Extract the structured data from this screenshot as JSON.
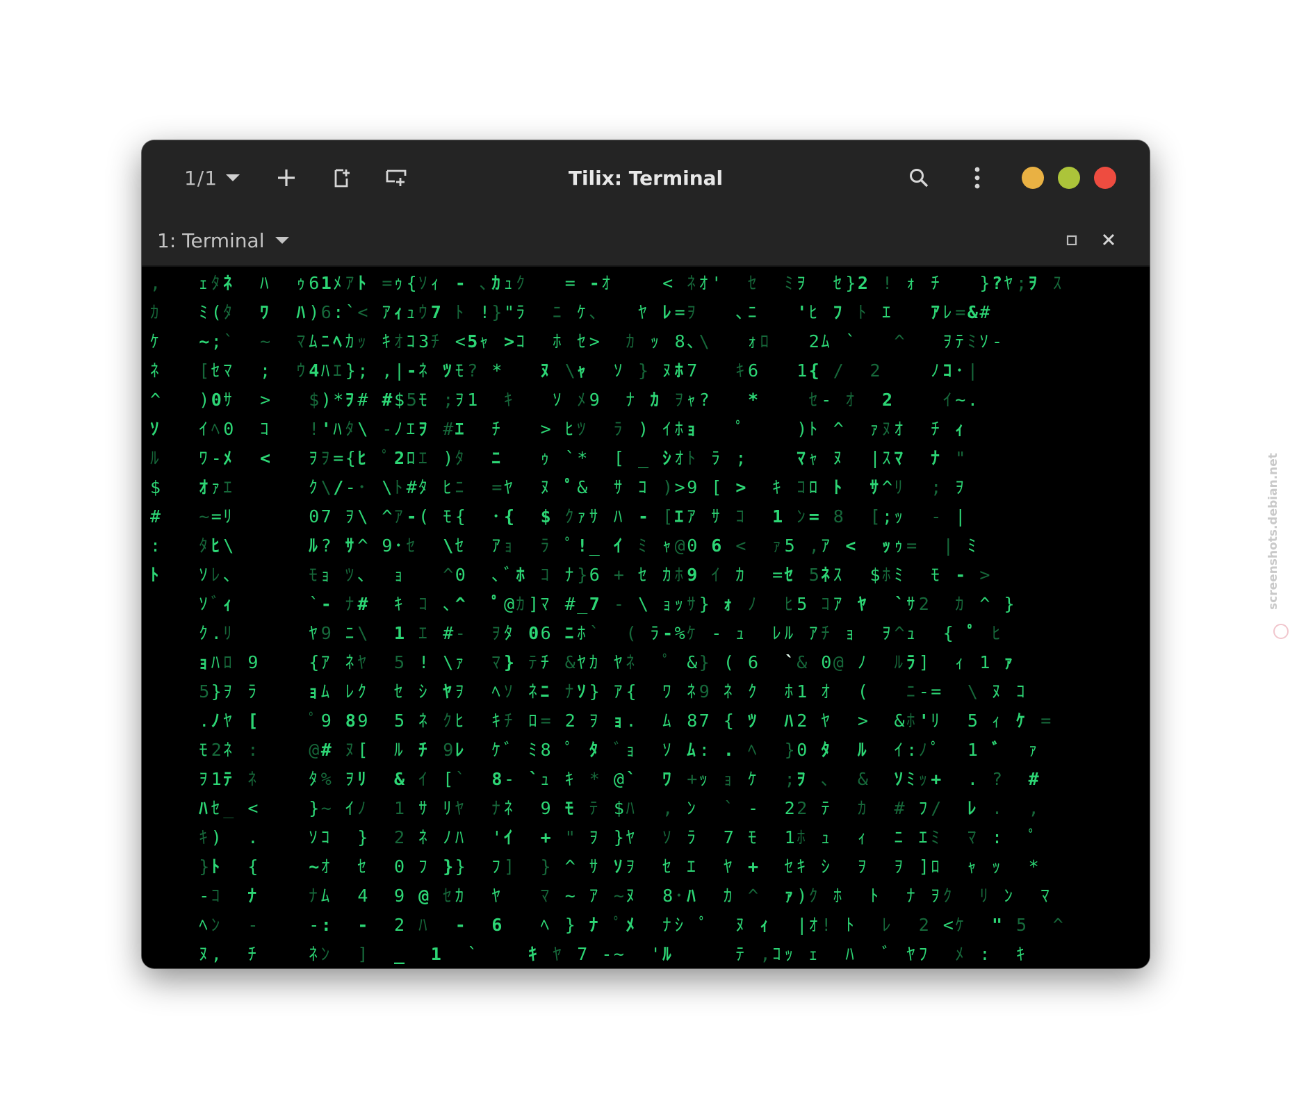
{
  "app": {
    "window_title": "Tilix: Terminal",
    "session_switcher": "1/1",
    "terminal_title": "1: Terminal"
  },
  "icons": {
    "session_dropdown": "chevron-down-icon",
    "add_terminal": "plus-icon",
    "split_horizontal": "split-horizontal-icon",
    "split_vertical": "split-vertical-icon",
    "find": "search-icon",
    "menu": "kebab-menu-icon",
    "terminal_menu": "chevron-down-icon",
    "terminal_maximize": "maximize-icon",
    "terminal_close": "close-icon"
  },
  "window_controls": {
    "minimize_color": "#e9b143",
    "maximize_color": "#acc43a",
    "close_color": "#ee4c40"
  },
  "colors": {
    "matrix_green": "#2dd675",
    "matrix_green_dim": "#16683a",
    "matrix_head": "#e6fff0",
    "headerbar": "#242424"
  },
  "terminal": {
    "program": "cmatrix",
    "rows": [
      ",   ｪﾀﾈ  ﾊ  ｩ61ﾒｱﾄ =ｩ{ｿｨ - ､ｶｭｸ   = -ｵ    < ﾈｵ'  ｾ  ﾐｦ  ｾ}2 ! ｫ ﾁ   }?ﾔ;ｦ ｽ",
      "ｶ   ﾐ(ﾀ  ﾜ  ﾊ)6:`< ｱｨｭｳ7 ﾄ !}\"ﾗ  ﾆ ｹ､   ﾔ ﾚ=ｦ   ､ﾆ   'ﾋ ﾌ ﾄ ｴ   ｱﾚ=&#",
      "ｹ   ~;`  ~  ﾏﾑﾆﾍｶｯ ｷｵｺ3ﾁ <5ｬ >ｺ  ﾎ ｾ>  ｶ ｯ 8､\\   ｫﾛ   2ﾑ `   ^   ｦﾃﾐｿ-",
      "ﾈ   [ｾﾏ  ;  ｳ4ﾊｴ}; ,|-ﾈ ﾂﾓ? *   ﾇ \\ｬ  ｿ } ﾇﾎ7   ｷ6   1{ /  2    ﾉｺ･|",
      "^   )0ｻ  >   $)*ｦ# #$5ﾓ ;ｦ1  ｷ   ｿ ﾒ9  ﾅ ｶ ｦｬ?   *    ｾ- ｵ  2    ｲ~.",
      "ｿ   ｲﾍ0  ｺ   !'ﾊﾀ\\ -ﾉｴｦ #ｴ  ﾁ   > ﾋﾂ  ﾗ ) ｲﾎｮ   ﾟ    )ﾄ ^  ｧﾇｵ  ﾁ ｨ",
      "ﾙ   ﾜ-ﾒ  <   ｦｦ={ﾋ ﾟ2ﾛｴ )ﾀ  ﾆ   ｩ `*  [ _ ｼｵﾄ ﾗ ;    ﾏｬ ﾇ  |ｽﾏ  ﾅ \"",
      "$   ｵｧｴ      ｸ\\/-･ \\ﾄ#ﾀ ﾋﾆ  =ﾔ  ﾇ ﾟ&  ｻ ｺ )>9 [ >  ｷ ｺﾛ ﾄ  ｻ^ﾘ  ; ｦ",
      "#   ~=ﾘ      07 ｦ\\ ^ｱ-( ﾓ{  ･{  $ ｸｧｻ ﾊ - [ｴｱ ｻ ｺ  1 ﾝ= 8  [;ｯ  - |",
      ":   ﾀﾋ\\      ﾙ? ｻ^ 9･ｾ  \\ｾ  ｱｮ  ﾗ ﾟ!_ ｲ ﾐ ｬ@0 6 <  ｧ5 ,ｱ <  ｯｩ=  | ﾐ",
      "ﾄ   ｿﾚ､      ﾓｮ ﾂ､  ｮ   ^0  ､ﾞﾎ ｺ ﾅ}6 + ｾ ｶﾎ9 ｲ ｶ  =ｾ 5ﾈｽ  $ﾎﾐ  ﾓ - >",
      "    ｿﾞｨ      `- ﾅ#  ｷ ｺ ､^  ﾟ@ｶ]ﾏ #_7 - \\ ｮｯｻ} ｫ ﾉ  ﾋ5 ｺｱ ﾔ  `ｻ2  ｶ ^ }",
      "    ｸ.ﾘ      ﾔ9 ﾆ\\  1 ｴ #-  ｦﾀ 06 ﾆﾎ`  ( ﾗ-%ｹ - ｭ  ﾚﾙ ｱﾁ ｮ  ｦ^ｭ  { ﾟ ﾋ",
      "    ｮﾊﾛ 9    {ｱ ﾈﾔ  5 ! \\ｧ  ﾏ} ﾃﾁ &ﾔｶ ﾔﾈ  ﾟ &} ( 6  `& 0@ ﾉ  ﾙﾗ]  ｨ 1 ｧ",
      "    5}ｦ ﾗ    ｮﾑ ﾚｸ  ｾ ｼ ﾔｦ  ﾍｿ ﾈﾆ ﾅｿ} ｱ{  ﾜ ﾈ9 ﾈ ｸ  ﾎ1 ｵ  (   ﾆ-=  \\ ﾇ ｺ",
      "    .ﾉﾔ [    ﾟ9 89  5 ﾈ ｸﾋ  ｷﾁ ﾛ= 2 ｦ ｮ.  ﾑ 87 { ﾂ  ﾊ2 ﾔ  >  &ﾎ'ﾘ  5 ｨ ｹ =",
      "    ﾓ2ﾈ :    @# ﾇ[  ﾙ ﾁ 9ﾚ  ｹﾞ ﾐ8 ﾟ ﾀ ﾞｮ  ｿ ﾑ: . ﾍ  }0 ﾀ  ﾙ  ｲ:ﾉﾟ  1 ﾞ  ｧ",
      "    ｦ1ﾃ ﾈ    ﾀ% ｦﾘ  & ｲ [`  8- `ｭ ｷ * @`  ﾜ +ｯ ｮ ｹ  ;ｦ ､  &  ｿﾐｯ+  . ?  #",
      "    ﾊｾ_ <    }~ ｲﾉ  1 ｻ ﾘﾔ  ﾅﾈ  9 ﾓ ﾃ $ﾊ  , ﾝ  ` -  22 ﾃ  ｶ  # ﾌ/  ﾚ .  ,",
      "    ｷ)  .    ｿｺ  }  2 ﾈ ﾉﾊ  'ｲ  + \" ｦ }ﾔ  ｿ ﾗ  7 ﾓ  1ﾎ ｭ  ｨ  ﾆ ｴﾐ  ﾏ :  ﾟ",
      "    }ﾄ  {    ~ｵ  ｾ  0 ﾌ }}  ﾌ]  } ^ ｻ ｿｦ  ｾ ｴ  ﾔ +  ｾｷ ｼ  ｦ  ｦ ]ﾛ  ｬ ｯ  *",
      "    -ｺ  ﾅ    ﾅﾑ  4  9 @ ｾｶ  ﾔ   ﾏ ~ ｱ ~ﾇ  8･ﾊ  ｶ ^  ｧ)ｸ ﾎ  ﾄ  ﾅ ｦｸ  ﾘ ﾝ  ﾏ",
      "    ﾍﾝ  -    -:  -  2 ﾊ  -  6   ﾍ } ﾅ ﾟﾒ  ﾅｼ ﾟ  ﾇ ｨ  |ｵ! ﾄ  ﾚ  2 <ｹ  \" 5  ^",
      "    ﾇ,  ﾁ    ﾈﾝ  ]  _  1  `    ｷ ﾔ 7 -~  'ﾙ     ﾃ ,ｺｯ ｪ  ﾊ  ﾞ ﾔﾌ  ﾒ :  ｷ"
    ]
  }
}
